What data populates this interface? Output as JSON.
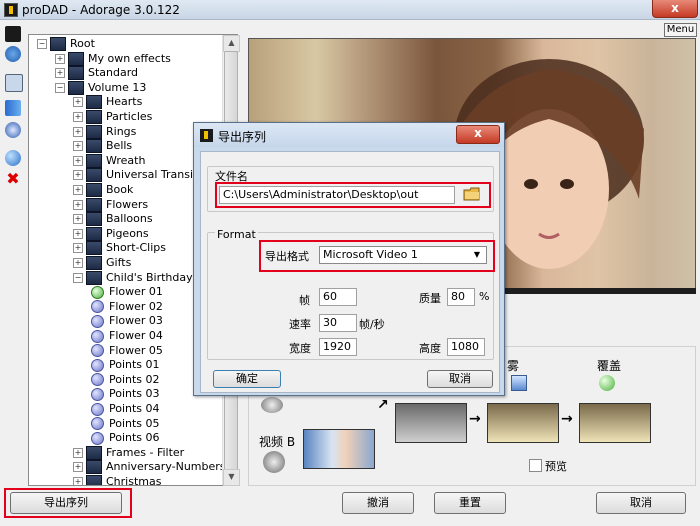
{
  "window": {
    "title": "proDAD - Adorage 3.0.122",
    "close_label": "x",
    "menu_label": "Menu"
  },
  "tree": {
    "items": [
      {
        "label": "Root",
        "level": 0
      },
      {
        "label": "My own effects",
        "level": 1
      },
      {
        "label": "Standard",
        "level": 1
      },
      {
        "label": "Volume 13",
        "level": 1
      },
      {
        "label": "Hearts",
        "level": 2
      },
      {
        "label": "Particles",
        "level": 2
      },
      {
        "label": "Rings",
        "level": 2
      },
      {
        "label": "Bells",
        "level": 2
      },
      {
        "label": "Wreath",
        "level": 2
      },
      {
        "label": "Universal Transitions",
        "level": 2
      },
      {
        "label": "Book",
        "level": 2
      },
      {
        "label": "Flowers",
        "level": 2
      },
      {
        "label": "Balloons",
        "level": 2
      },
      {
        "label": "Pigeons",
        "level": 2
      },
      {
        "label": "Short-Clips",
        "level": 2
      },
      {
        "label": "Gifts",
        "level": 2
      },
      {
        "label": "Child's Birthday",
        "level": 2
      },
      {
        "label": "Flower 01",
        "level": 3,
        "selected": true
      },
      {
        "label": "Flower 02",
        "level": 3
      },
      {
        "label": "Flower 03",
        "level": 3
      },
      {
        "label": "Flower 04",
        "level": 3
      },
      {
        "label": "Flower 05",
        "level": 3
      },
      {
        "label": "Points 01",
        "level": 3
      },
      {
        "label": "Points 02",
        "level": 3
      },
      {
        "label": "Points 03",
        "level": 3
      },
      {
        "label": "Points 04",
        "level": 3
      },
      {
        "label": "Points 05",
        "level": 3
      },
      {
        "label": "Points 06",
        "level": 3
      },
      {
        "label": "Frames - Filter",
        "level": 2
      },
      {
        "label": "Anniversary-Numbers",
        "level": 2
      },
      {
        "label": "Christmas",
        "level": 2
      }
    ]
  },
  "lower": {
    "label_fog": "雾",
    "label_overlay": "覆盖",
    "label_video_b": "视频 B",
    "preview_check": "预览"
  },
  "bottom": {
    "export_button": "导出序列",
    "undo_button": "撤消",
    "reset_button": "重置",
    "cancel_button": "取消"
  },
  "dialog": {
    "title": "导出序列",
    "close_label": "x",
    "filename_group": "文件名",
    "filename_value": "C:\\Users\\Administrator\\Desktop\\out",
    "format_group": "Format",
    "export_format_label": "导出格式",
    "export_format_value": "Microsoft Video 1",
    "frames_label": "帧",
    "frames_value": "60",
    "quality_label": "质量",
    "quality_value": "80",
    "quality_unit": "%",
    "rate_label": "速率",
    "rate_value": "30",
    "rate_unit": "帧/秒",
    "width_label": "宽度",
    "width_value": "1920",
    "height_label": "高度",
    "height_value": "1080",
    "ok_button": "确定",
    "cancel_button": "取消"
  },
  "colors": {
    "highlight_red": "#e3001b",
    "title_bar": "#c9d6e6"
  }
}
